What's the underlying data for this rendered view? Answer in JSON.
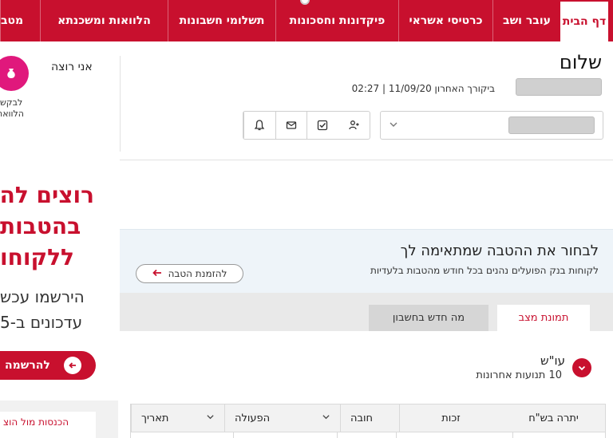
{
  "nav": {
    "tabs": [
      {
        "label": "דף הבית",
        "active": true
      },
      {
        "label": "עובר ושב"
      },
      {
        "label": "כרטיסי אשראי"
      },
      {
        "label": "פיקדונות וחסכונות"
      },
      {
        "label": "תשלומי חשבונות"
      },
      {
        "label": "הלוואות ומשכנתא"
      },
      {
        "label": "מטב"
      }
    ]
  },
  "header": {
    "greeting": "שלום",
    "last_visit": "ביקורך האחרון 11/09/20 | 02:27"
  },
  "toolbar": {
    "icons": [
      "bell-icon",
      "envelope-icon",
      "checkbox-icon",
      "person-transfer-icon"
    ]
  },
  "side_promo": {
    "want_label": "אני רוצה",
    "want_sub": [
      "לבקש",
      "הלוואה"
    ],
    "headline": [
      "רוצים לה",
      "בהטבות",
      "ללקוחו"
    ],
    "subline": [
      "הירשמו עכש",
      "עדכונים ב-5"
    ],
    "register_label": "להרשמה",
    "bottom_tab": "הכנסות מול הוצ"
  },
  "banner": {
    "title": "לבחור את ההטבה שמתאימה לך",
    "subtitle": "לקוחות בנק הפועלים נהנים בכל חודש מהטבות בלעדיות",
    "button_label": "להזמנת הטבה"
  },
  "content_tabs": [
    {
      "label": "תמונת מצב",
      "active": true
    },
    {
      "label": "מה חדש בחשבון"
    }
  ],
  "section": {
    "title": "עו\"ש",
    "subtitle": "10 תנועות אחרונות"
  },
  "table": {
    "columns": [
      "תאריך",
      "הפעולה",
      "חובה",
      "זכות",
      "יתרה בש\"ח"
    ]
  },
  "colors": {
    "brand_red": "#c8102e",
    "accent_pink": "#e0187c",
    "banner_bg": "#eef4f9"
  }
}
